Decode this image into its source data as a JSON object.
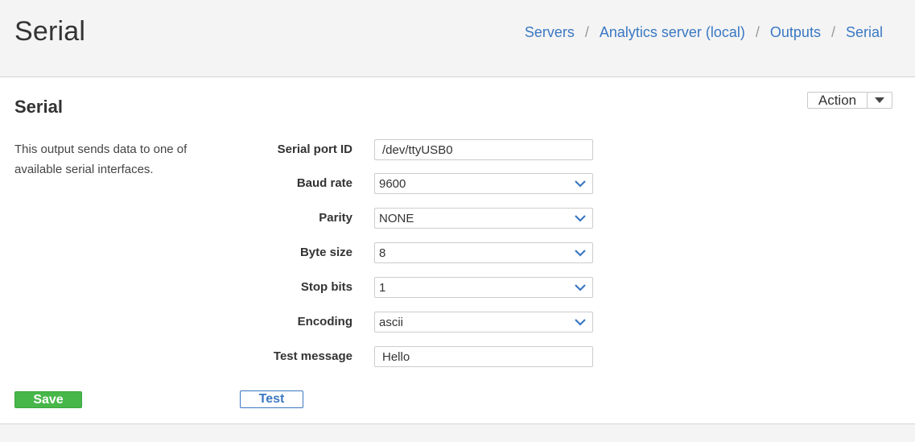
{
  "header": {
    "title": "Serial",
    "breadcrumb": [
      {
        "label": "Servers"
      },
      {
        "label": "Analytics server (local)"
      },
      {
        "label": "Outputs"
      },
      {
        "label": "Serial"
      }
    ],
    "separator": "/"
  },
  "panel": {
    "title": "Serial",
    "action_label": "Action",
    "description": "This output sends data to one of available serial interfaces.",
    "fields": {
      "serial_port_id": {
        "label": "Serial port ID",
        "value": "/dev/ttyUSB0"
      },
      "baud_rate": {
        "label": "Baud rate",
        "value": "9600"
      },
      "parity": {
        "label": "Parity",
        "value": "NONE"
      },
      "byte_size": {
        "label": "Byte size",
        "value": "8"
      },
      "stop_bits": {
        "label": "Stop bits",
        "value": "1"
      },
      "encoding": {
        "label": "Encoding",
        "value": "ascii"
      },
      "test_message": {
        "label": "Test message",
        "value": "Hello"
      }
    },
    "save_label": "Save",
    "test_label": "Test"
  },
  "colors": {
    "link": "#3a78c3",
    "save_button": "#48b74a",
    "header_bg": "#f4f4f4",
    "panel_bg": "#ffffff"
  },
  "icons": {
    "action_caret": "caret-down-icon",
    "select_chevron": "chevron-down-icon"
  }
}
